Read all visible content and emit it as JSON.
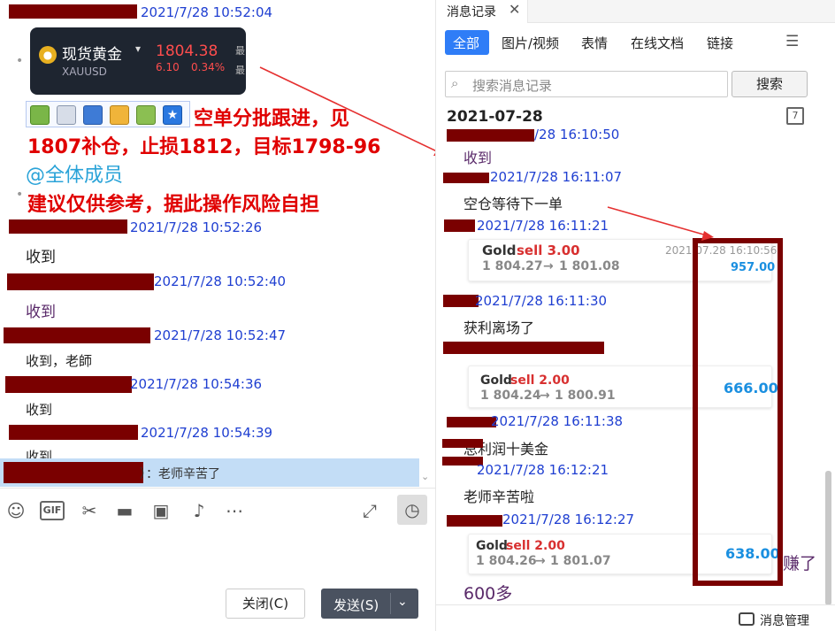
{
  "left": {
    "messages": [
      {
        "time": "2021/7/28 10:52:04"
      },
      {
        "time": "2021/7/28 10:52:26",
        "text": "收到"
      },
      {
        "time": "2021/7/28 10:52:40",
        "text": "收到"
      },
      {
        "time": "2021/7/28 10:52:47",
        "text": "收到，老師"
      },
      {
        "time": "2021/7/28 10:54:36",
        "text": "收到"
      },
      {
        "time": "2021/7/28 10:54:39",
        "text": "收到"
      }
    ],
    "widget": {
      "name": "现货黄金",
      "code": "XAUUSD",
      "price": "1804.38",
      "change": "6.10",
      "change_pct": "0.34%",
      "side_label_1": "最",
      "side_label_2": "最"
    },
    "announcement": {
      "line1": "空单分批跟进，见",
      "line2": "1807补仓，止损1812，目标1798-96",
      "mention": "@全体成员",
      "line4": "建议仅供参考，据此操作风险自担"
    },
    "reply_quote": "）：老师辛苦了",
    "buttons": {
      "close": "关闭(C)",
      "send": "发送(S)"
    }
  },
  "right": {
    "panel_tab": "消息记录",
    "filter_tabs": [
      "全部",
      "图片/视频",
      "表情",
      "在线文档",
      "链接"
    ],
    "search": {
      "placeholder": "搜索消息记录",
      "button": "搜索"
    },
    "date": "2021-07-28",
    "messages": [
      {
        "time": "/28 16:10:50",
        "text": "收到"
      },
      {
        "time": "2021/7/28 16:11:07",
        "text": "空仓等待下一单"
      },
      {
        "time": "2021/7/28 16:11:21"
      },
      {
        "time": "2021/7/28 16:11:30",
        "text": "获利离场了"
      },
      {
        "time": "2021/7/28 16:11:38",
        "text": "总利润十美金"
      },
      {
        "time": "2021/7/28 16:12:21",
        "text": "老师辛苦啦"
      },
      {
        "time": "2021/7/28 16:12:27"
      }
    ],
    "trades": [
      {
        "symbol": "Gold",
        "side": "sell 3.00",
        "price_from": "1 804.27",
        "price_to": "1 801.08",
        "time": "2021.07.28 16:10:56",
        "profit": "957.00"
      },
      {
        "symbol": "Gold",
        "side": "sell 2.00",
        "price_from": "1 804.24",
        "price_to": "1 800.91",
        "profit": "666.00"
      },
      {
        "symbol": "Gold",
        "side": "sell 2.00",
        "price_from": "1 804.26",
        "price_to": "1 801.07",
        "profit": "638.00"
      }
    ],
    "overflow_text": "赚了",
    "last_text": "600多",
    "footer": "消息管理"
  }
}
